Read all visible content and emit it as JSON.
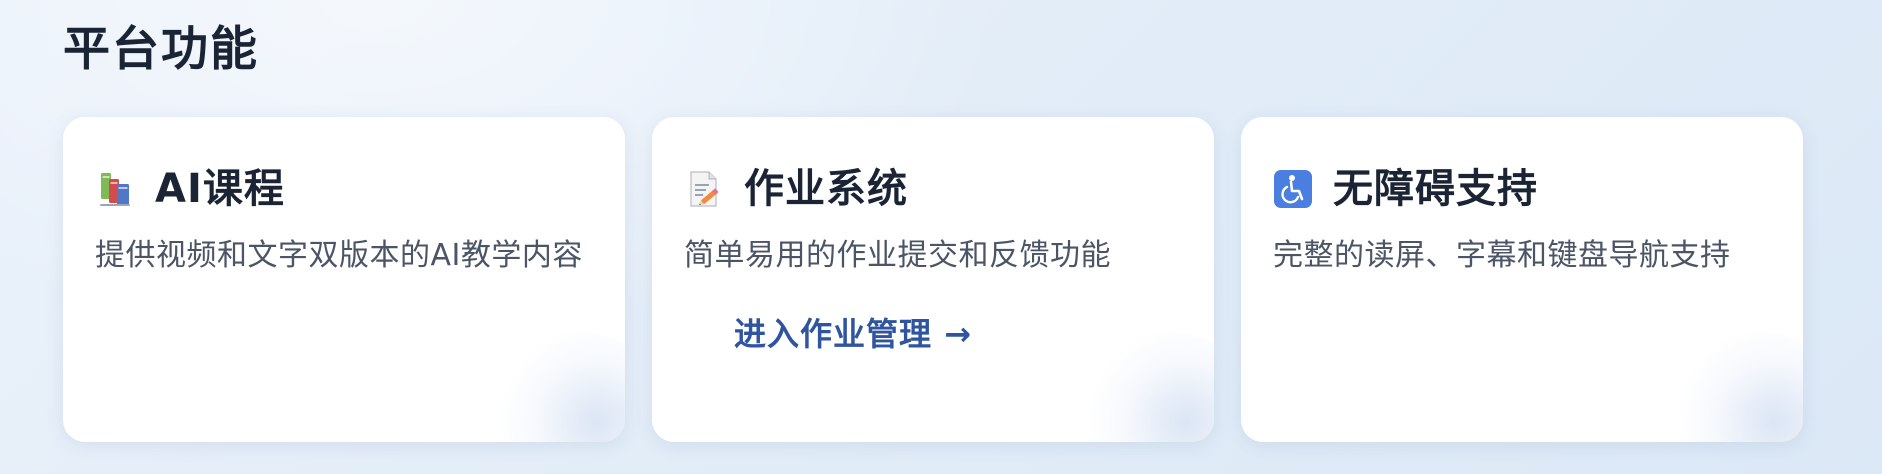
{
  "section": {
    "title": "平台功能"
  },
  "cards": [
    {
      "icon": "books-icon",
      "title": "AI课程",
      "description": "提供视频和文字双版本的AI教学内容"
    },
    {
      "icon": "memo-icon",
      "title": "作业系统",
      "description": "简单易用的作业提交和反馈功能",
      "link_label": "进入作业管理 →"
    },
    {
      "icon": "wheelchair-icon",
      "title": "无障碍支持",
      "description": "完整的读屏、字幕和键盘导航支持"
    }
  ],
  "colors": {
    "title": "#1b2435",
    "text": "#4b5566",
    "link": "#2f54a0",
    "accessibility_icon": "#4a7ee0"
  }
}
